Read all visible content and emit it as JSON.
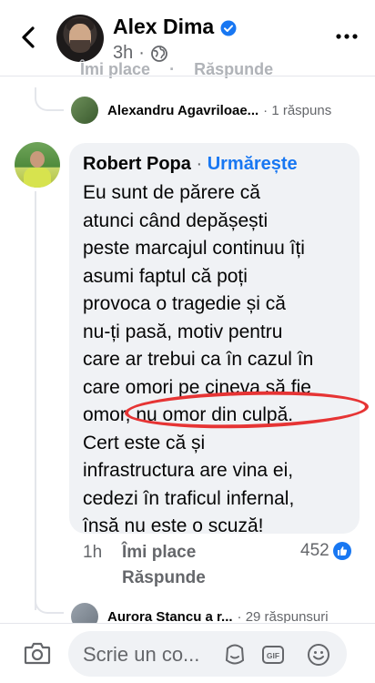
{
  "header": {
    "name": "Alex Dima",
    "time": "3h",
    "verified_color": "#1877f2"
  },
  "previous_actions": {
    "like": "Îmi place",
    "reply": "Răspunde"
  },
  "reply_previews": [
    {
      "name": "Alexandru Agavriloae...",
      "count": "· 1 răspuns"
    },
    {
      "name": "Aurora Stancu a r...",
      "count": "· 29 răspunsuri"
    }
  ],
  "comment": {
    "author": "Robert Popa",
    "separator": "·",
    "follow": "Urmărește",
    "lines": [
      "Eu sunt de părere că",
      "atunci când depășești",
      "peste marcajul continuu îți",
      "asumi faptul că poți",
      "provoca o tragedie și că",
      "nu-ți pasă, motiv pentru",
      "care ar trebui ca în cazul în",
      "care omori pe cineva să fie",
      "omor, nu omor din culpă.",
      "Cert este că și",
      "infrastructura are vina ei,",
      "cedezi în traficul infernal,",
      "însă nu este o scuză!"
    ],
    "time": "1h",
    "like_label": "Îmi place",
    "reply_label": "Răspunde",
    "reaction_count": "452"
  },
  "composer": {
    "placeholder": "Scrie un co..."
  },
  "colors": {
    "accent": "#1877f2",
    "highlight": "#e63434",
    "bubble": "#f0f2f5"
  }
}
